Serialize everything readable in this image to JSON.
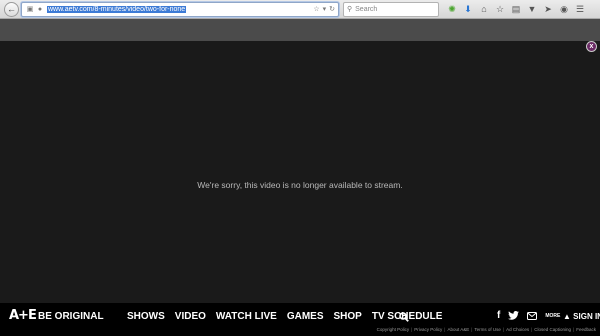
{
  "browser": {
    "url": "www.aetv.com/8-minutes/video/two-for-none",
    "search_placeholder": "Search"
  },
  "player": {
    "message": "We're sorry, this video is no longer available to stream.",
    "close_label": "x"
  },
  "nav": {
    "logo": "A+E",
    "tagline": "BE ORIGINAL",
    "links": [
      "SHOWS",
      "VIDEO",
      "WATCH LIVE",
      "GAMES",
      "SHOP",
      "TV SCHEDULE"
    ],
    "more_label": "MORE",
    "signin_label": "SIGN IN"
  },
  "footer": {
    "links": [
      "Copyright Policy",
      "Privacy Policy",
      "About A&E",
      "Terms of Use",
      "Ad Choices",
      "Closed Captioning",
      "Feedback"
    ]
  },
  "colors": {
    "page_bg": "#1a1a1a",
    "gray_bar": "#4b4b4b",
    "nav_bg": "#000000",
    "url_highlight": "#3d7bd6",
    "close_btn": "#6a2a64"
  }
}
